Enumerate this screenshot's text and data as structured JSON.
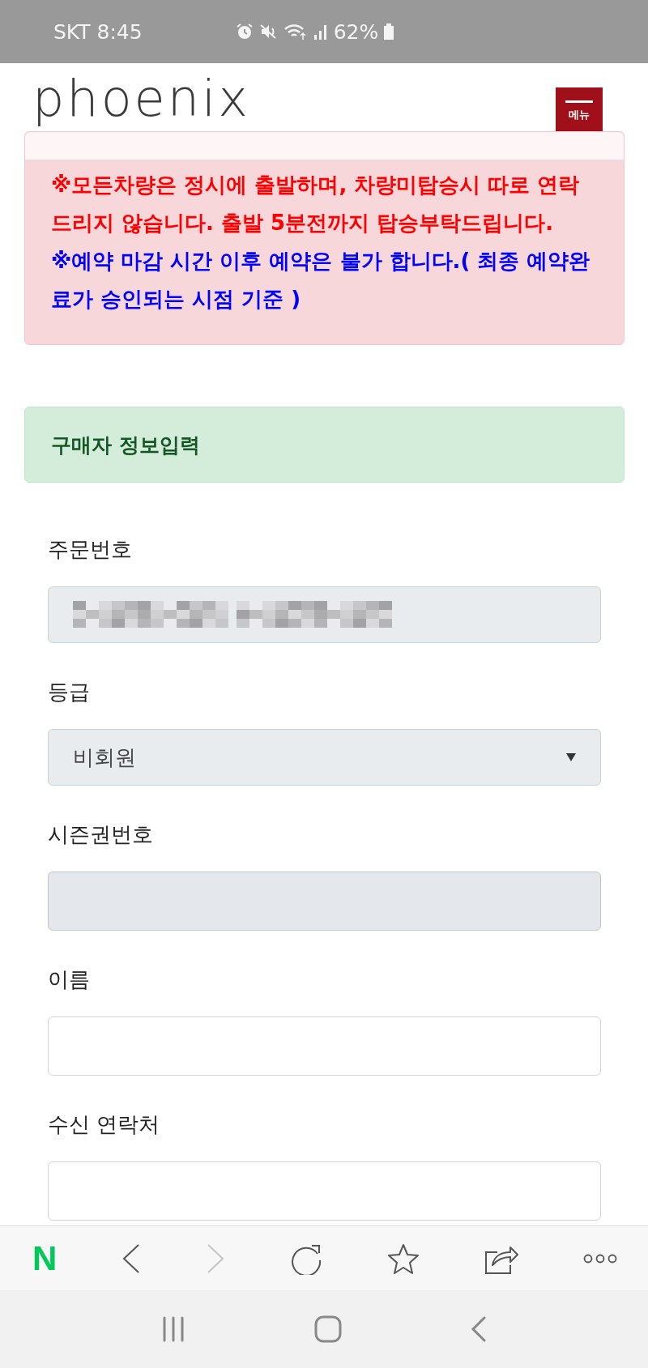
{
  "status_bar": {
    "carrier_time": "SKT 8:45",
    "battery": "62%"
  },
  "header": {
    "logo": "phoenix",
    "menu_label": "메뉴"
  },
  "notices": [
    {
      "text": "※모든차량은 정시에 출발하며, 차량미탑승시 따로 연락드리지 않습니다. 출발 5분전까지 탑승부탁드립니다.",
      "color": "#ff0000"
    },
    {
      "text": "※예약 마감 시간 이후 예약은 불가 합니다.( 최종 예약완료가 승인되는 시점 기준 )",
      "color": "#0000ff"
    }
  ],
  "section_title": "구매자 정보입력",
  "fields": [
    {
      "label": "주문번호",
      "kind": "redacted",
      "disabled": true
    },
    {
      "label": "등급",
      "kind": "select",
      "value": "비회원",
      "disabled": true
    },
    {
      "label": "시즌권번호",
      "kind": "input",
      "disabled": true
    },
    {
      "label": "이름",
      "kind": "input",
      "disabled": false
    },
    {
      "label": "수신 연락처",
      "kind": "input",
      "disabled": false
    }
  ],
  "toolbar": {
    "home_label": "N",
    "forward": {
      "disabled": true
    }
  }
}
